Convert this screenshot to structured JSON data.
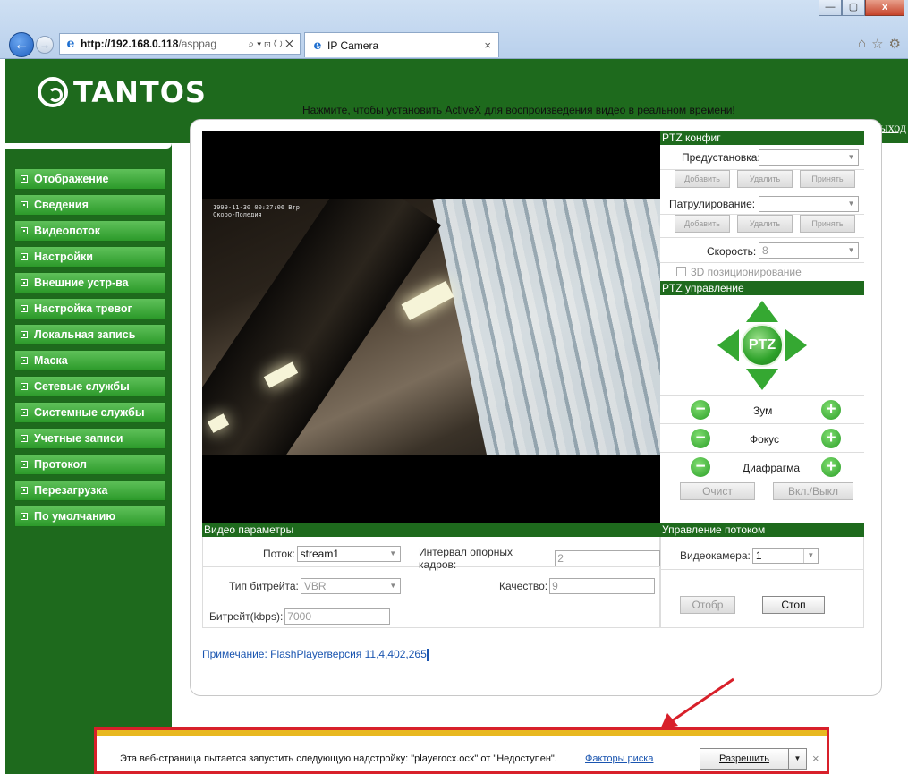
{
  "browser": {
    "url_host": "http://192.168.0.118",
    "url_rest": "/asppag",
    "tab_title": "IP Camera",
    "window_buttons": [
      "—",
      "▢",
      "x"
    ]
  },
  "header": {
    "logo_text": "TANTOS",
    "exit_label": "Выход"
  },
  "sidebar": {
    "items": [
      {
        "label": "Отображение"
      },
      {
        "label": "Сведения"
      },
      {
        "label": "Видеопоток"
      },
      {
        "label": "Настройки"
      },
      {
        "label": "Внешние устр-ва"
      },
      {
        "label": "Настройка тревог"
      },
      {
        "label": "Локальная запись"
      },
      {
        "label": "Маска"
      },
      {
        "label": "Сетевые службы"
      },
      {
        "label": "Системные службы"
      },
      {
        "label": "Учетные записи"
      },
      {
        "label": "Протокол"
      },
      {
        "label": "Перезагрузка"
      },
      {
        "label": "По умолчанию"
      }
    ]
  },
  "install_link": "Нажмите, чтобы установить ActiveX для воспроизведения видео в реальном времени!",
  "video": {
    "osd_line1": "1999-11-30 00:27:06 Втр",
    "osd_line2": "Скоро-Поледия"
  },
  "ptz_config": {
    "title": "PTZ конфиг",
    "preset_label": "Предустановка:",
    "preset_value": "",
    "patrol_label": "Патрулирование:",
    "patrol_value": "",
    "btn_add": "Добавить",
    "btn_delete": "Удалить",
    "btn_apply": "Принять",
    "speed_label": "Скорость:",
    "speed_value": "8",
    "pos3d_label": "3D позиционирование"
  },
  "ptz_control": {
    "title": "PTZ управление",
    "center_label": "PTZ",
    "zoom_label": "Зум",
    "focus_label": "Фокус",
    "iris_label": "Диафрагма",
    "btn_clear": "Очист",
    "btn_onoff": "Вкл./Выкл"
  },
  "video_params": {
    "title": "Видео параметры",
    "stream_label": "Поток:",
    "stream_value": "stream1",
    "keyframe_label": "Интервал опорных кадров:",
    "keyframe_value": "2",
    "bitrate_type_label": "Тип битрейта:",
    "bitrate_type_value": "VBR",
    "quality_label": "Качество:",
    "quality_value": "9",
    "bitrate_label": "Битрейт(kbps):",
    "bitrate_value": "7000"
  },
  "stream_control": {
    "title": "Управление потоком",
    "camera_label": "Видеокамера:",
    "camera_value": "1",
    "btn_show": "Отобр",
    "btn_stop": "Стоп"
  },
  "note": "Примечание: FlashPlayerверсия 11,4,402,265",
  "notification": {
    "text": "Эта веб-страница пытается запустить следующую надстройку: \"playerocx.ocx\" от \"Недоступен\".",
    "risk_link": "Факторы риска",
    "allow_label": "Разрешить",
    "close": "×"
  },
  "colors": {
    "brand_green": "#1e6a1d",
    "menu_green": "#2c9a2a",
    "alert_red": "#d8202a"
  }
}
